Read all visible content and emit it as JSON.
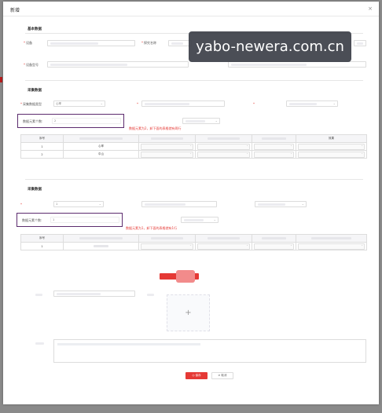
{
  "modal": {
    "title": "新增",
    "close": "×"
  },
  "sections": {
    "basic": "基本数据",
    "collect1": "采集数据",
    "collect2": "采集数据"
  },
  "labels": {
    "device_name": "设备",
    "model_name": "探究名称",
    "basic_row2": "设备型号",
    "collect_type": "采集数据类型",
    "count_label": "数据元素个数:",
    "count_label2": "数据元素个数:"
  },
  "values": {
    "count1": "2",
    "count2": "1",
    "collect_type_value": "心率",
    "row2_select": "1"
  },
  "notes": {
    "note1": "数据元素为2，卸下面的表格就有两行",
    "note2": "数据元素为1，卸下面的表格就有1行"
  },
  "table1": {
    "headers": [
      "序号",
      "",
      "",
      "",
      "",
      "效果"
    ],
    "rows": [
      {
        "index": "1",
        "name": "心率"
      },
      {
        "index": "2",
        "name": "中山"
      }
    ]
  },
  "table2": {
    "headers": [
      "序号",
      "",
      "",
      "",
      "",
      ""
    ],
    "rows": [
      {
        "index": "1",
        "name": ""
      }
    ]
  },
  "actions": {
    "add_button": "新增",
    "upload_plus": "+",
    "save": "保存",
    "cancel": "取消"
  },
  "watermark": "yabo-newera.com.cn"
}
